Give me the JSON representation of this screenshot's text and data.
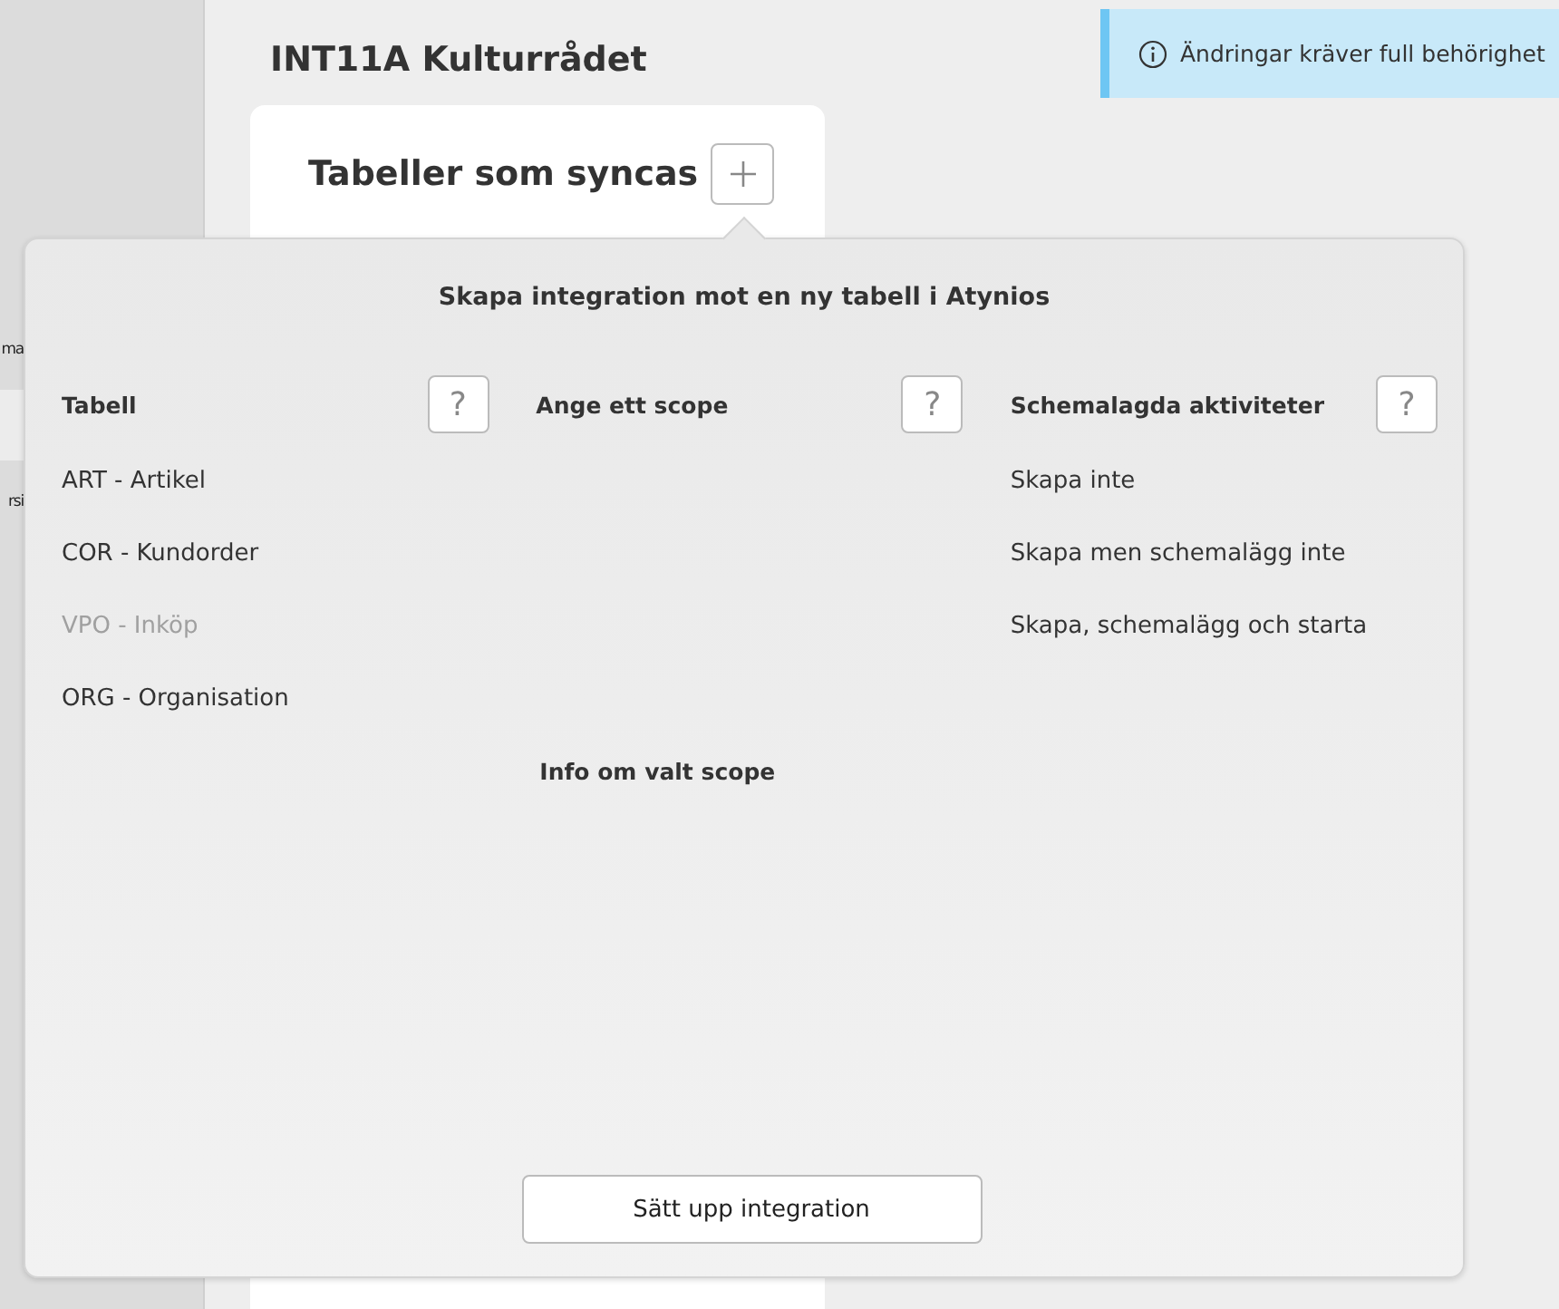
{
  "sidebar": {
    "items": [
      {
        "label": "ma",
        "selected": false
      },
      {
        "selected": true
      },
      {
        "label": "rsi",
        "selected": false
      }
    ]
  },
  "page": {
    "title": "INT11A Kulturrådet",
    "card_title": "Tabeller som syncas"
  },
  "notice": {
    "text": "Ändringar kräver full behörighet"
  },
  "popover": {
    "title": "Skapa integration mot en ny tabell i Atynios",
    "columns": [
      {
        "heading": "Tabell",
        "help": "?",
        "items": [
          {
            "label": "ART - Artikel",
            "disabled": false
          },
          {
            "label": "COR - Kundorder",
            "disabled": false
          },
          {
            "label": "VPO - Inköp",
            "disabled": true
          },
          {
            "label": "ORG - Organisation",
            "disabled": false
          }
        ]
      },
      {
        "heading": "Ange ett scope",
        "help": "?",
        "info": "Info om valt scope"
      },
      {
        "heading": "Schemalagda aktiviteter",
        "help": "?",
        "items": [
          {
            "label": "Skapa inte",
            "disabled": false
          },
          {
            "label": "Skapa men schemalägg inte",
            "disabled": false
          },
          {
            "label": "Skapa, schemalägg och starta",
            "disabled": false
          }
        ]
      }
    ],
    "button": "Sätt upp integration"
  }
}
